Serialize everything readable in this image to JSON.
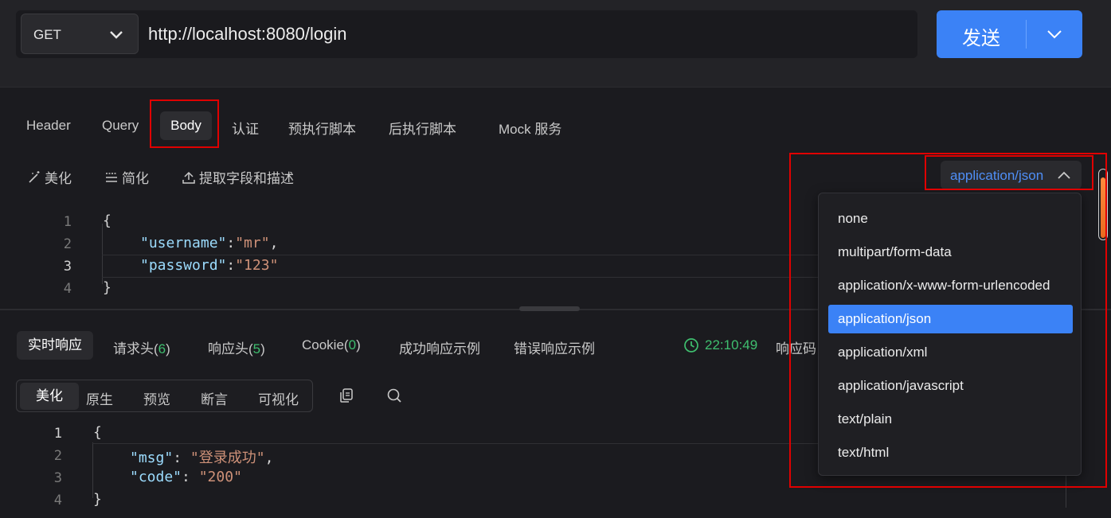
{
  "request": {
    "method": "GET",
    "url": "http://localhost:8080/login",
    "send_label": "发送"
  },
  "tabs": [
    {
      "label": "Header"
    },
    {
      "label": "Query"
    },
    {
      "label": "Body"
    },
    {
      "label": "认证"
    },
    {
      "label": "预执行脚本"
    },
    {
      "label": "后执行脚本"
    },
    {
      "label": "Mock 服务"
    }
  ],
  "body_tools": {
    "beautify": "美化",
    "simplify": "简化",
    "extract": "提取字段和描述"
  },
  "content_type": {
    "selected": "application/json",
    "options": [
      "none",
      "multipart/form-data",
      "application/x-www-form-urlencoded",
      "application/json",
      "application/xml",
      "application/javascript",
      "text/plain",
      "text/html"
    ]
  },
  "request_body": {
    "line_numbers": [
      "1",
      "2",
      "3",
      "4"
    ],
    "open_brace": "{",
    "close_brace": "}",
    "username_key": "\"username\"",
    "username_val": "\"mr\"",
    "password_key": "\"password\"",
    "password_val": "\"123\""
  },
  "response_tabs": {
    "realtime": "实时响应",
    "req_headers": "请求头(",
    "req_headers_count": "6",
    "resp_headers": "响应头(",
    "resp_headers_count": "5",
    "cookie": "Cookie(",
    "cookie_count": "0",
    "close_paren": ")",
    "success_example": "成功响应示例",
    "error_example": "错误响应示例"
  },
  "response_meta": {
    "time": "22:10:49",
    "code_label": "响应码"
  },
  "view_modes": {
    "beautify": "美化",
    "raw": "原生",
    "preview": "预览",
    "assert": "断言",
    "visualize": "可视化"
  },
  "response_body": {
    "line_numbers": [
      "1",
      "2",
      "3",
      "4"
    ],
    "open_brace": "{",
    "close_brace": "}",
    "msg_key": "\"msg\"",
    "msg_val": "\"登录成功\"",
    "code_key": "\"code\"",
    "code_val": "\"200\""
  },
  "colors": {
    "accent": "#3b82f6",
    "success": "#3fbf6f",
    "annotation": "#e00000"
  }
}
